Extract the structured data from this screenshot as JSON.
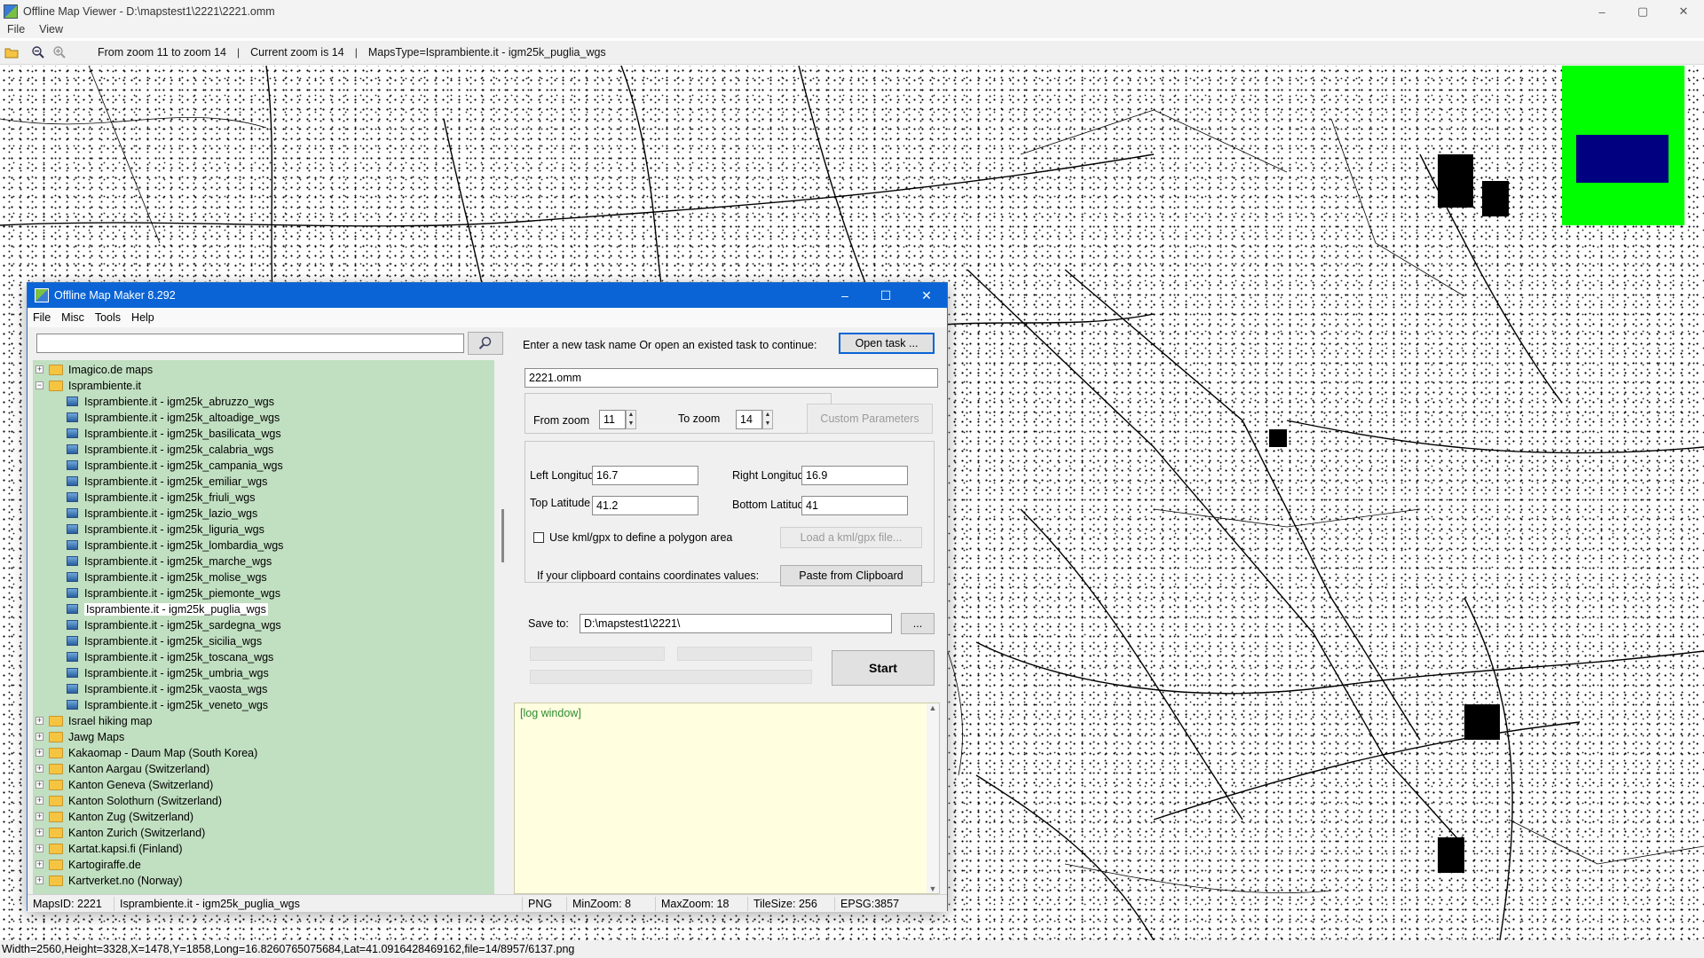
{
  "window": {
    "title": "Offline Map Viewer - D:\\mapstest1\\2221\\2221.omm",
    "minimize": "–",
    "maximize": "▢",
    "close": "✕"
  },
  "menu": {
    "file": "File",
    "view": "View"
  },
  "toolbar": {
    "zoom_range": "From zoom 11 to zoom 14",
    "separator": "|",
    "current_zoom": "Current zoom is 14",
    "maps_type": "MapsType=Isprambiente.it - igm25k_puglia_wgs"
  },
  "minimap": {
    "background_color": "#00ff00",
    "view_color": "#000080"
  },
  "dialog": {
    "title": "Offline Map Maker 8.292",
    "minimize": "–",
    "maximize": "☐",
    "close": "✕",
    "menu": {
      "file": "File",
      "misc": "Misc",
      "tools": "Tools",
      "help": "Help"
    },
    "search": {
      "value": "",
      "placeholder": ""
    },
    "tree": [
      {
        "label": "Imagico.de maps",
        "level": 0,
        "type": "folder",
        "expanded": false
      },
      {
        "label": "Isprambiente.it",
        "level": 0,
        "type": "folder",
        "expanded": true
      },
      {
        "label": "Isprambiente.it - igm25k_abruzzo_wgs",
        "level": 1,
        "type": "map"
      },
      {
        "label": "Isprambiente.it - igm25k_altoadige_wgs",
        "level": 1,
        "type": "map"
      },
      {
        "label": "Isprambiente.it - igm25k_basilicata_wgs",
        "level": 1,
        "type": "map"
      },
      {
        "label": "Isprambiente.it - igm25k_calabria_wgs",
        "level": 1,
        "type": "map"
      },
      {
        "label": "Isprambiente.it - igm25k_campania_wgs",
        "level": 1,
        "type": "map"
      },
      {
        "label": "Isprambiente.it - igm25k_emiliar_wgs",
        "level": 1,
        "type": "map"
      },
      {
        "label": "Isprambiente.it - igm25k_friuli_wgs",
        "level": 1,
        "type": "map"
      },
      {
        "label": "Isprambiente.it - igm25k_lazio_wgs",
        "level": 1,
        "type": "map"
      },
      {
        "label": "Isprambiente.it - igm25k_liguria_wgs",
        "level": 1,
        "type": "map"
      },
      {
        "label": "Isprambiente.it - igm25k_lombardia_wgs",
        "level": 1,
        "type": "map"
      },
      {
        "label": "Isprambiente.it - igm25k_marche_wgs",
        "level": 1,
        "type": "map"
      },
      {
        "label": "Isprambiente.it - igm25k_molise_wgs",
        "level": 1,
        "type": "map"
      },
      {
        "label": "Isprambiente.it - igm25k_piemonte_wgs",
        "level": 1,
        "type": "map"
      },
      {
        "label": "Isprambiente.it - igm25k_puglia_wgs",
        "level": 1,
        "type": "map",
        "selected": true
      },
      {
        "label": "Isprambiente.it - igm25k_sardegna_wgs",
        "level": 1,
        "type": "map"
      },
      {
        "label": "Isprambiente.it - igm25k_sicilia_wgs",
        "level": 1,
        "type": "map"
      },
      {
        "label": "Isprambiente.it - igm25k_toscana_wgs",
        "level": 1,
        "type": "map"
      },
      {
        "label": "Isprambiente.it - igm25k_umbria_wgs",
        "level": 1,
        "type": "map"
      },
      {
        "label": "Isprambiente.it - igm25k_vaosta_wgs",
        "level": 1,
        "type": "map"
      },
      {
        "label": "Isprambiente.it - igm25k_veneto_wgs",
        "level": 1,
        "type": "map"
      },
      {
        "label": "Israel hiking map",
        "level": 0,
        "type": "folder",
        "expanded": false
      },
      {
        "label": "Jawg Maps",
        "level": 0,
        "type": "folder",
        "expanded": false
      },
      {
        "label": "Kakaomap - Daum Map (South Korea)",
        "level": 0,
        "type": "folder",
        "expanded": false
      },
      {
        "label": "Kanton Aargau (Switzerland)",
        "level": 0,
        "type": "folder",
        "expanded": false
      },
      {
        "label": "Kanton Geneva (Switzerland)",
        "level": 0,
        "type": "folder",
        "expanded": false
      },
      {
        "label": "Kanton Solothurn (Switzerland)",
        "level": 0,
        "type": "folder",
        "expanded": false
      },
      {
        "label": "Kanton Zug (Switzerland)",
        "level": 0,
        "type": "folder",
        "expanded": false
      },
      {
        "label": "Kanton Zurich (Switzerland)",
        "level": 0,
        "type": "folder",
        "expanded": false
      },
      {
        "label": "Kartat.kapsi.fi (Finland)",
        "level": 0,
        "type": "folder",
        "expanded": false
      },
      {
        "label": "Kartogiraffe.de",
        "level": 0,
        "type": "folder",
        "expanded": false
      },
      {
        "label": "Kartverket.no (Norway)",
        "level": 0,
        "type": "folder",
        "expanded": false
      }
    ],
    "task": {
      "prompt": "Enter a new task name Or open an existed task to continue:",
      "open_button": "Open task ...",
      "name_value": "2221.omm"
    },
    "zoom": {
      "from_label": "From zoom",
      "from_value": "11",
      "to_label": "To zoom",
      "to_value": "14",
      "custom_button": "Custom Parameters"
    },
    "coords": {
      "left_lon_label": "Left Longitude",
      "left_lon_value": "16.7",
      "right_lon_label": "Right Longitude",
      "right_lon_value": "16.9",
      "top_lat_label": "Top Latitude",
      "top_lat_value": "41.2",
      "bottom_lat_label": "Bottom Latitude",
      "bottom_lat_value": "41",
      "kml_checkbox_label": "Use kml/gpx to define a polygon area",
      "kml_checked": false,
      "load_kml_button": "Load a kml/gpx file...",
      "clipboard_label": "If your clipboard contains coordinates values:",
      "paste_button": "Paste from Clipboard"
    },
    "save": {
      "label": "Save to:",
      "value": "D:\\mapstest1\\2221\\",
      "browse_button": "...",
      "start_button": "Start"
    },
    "log": {
      "text": "[log window]"
    },
    "status": {
      "maps_id": "MapsID: 2221",
      "maps_name": "Isprambiente.it - igm25k_puglia_wgs",
      "format": "PNG",
      "min_zoom": "MinZoom: 8",
      "max_zoom": "MaxZoom: 18",
      "tile_size": "TileSize: 256",
      "epsg": "EPSG:3857"
    }
  },
  "statusbar": {
    "text": "Width=2560,Height=3328,X=1478,Y=1858,Long=16.8260765075684,Lat=41.0916428469162,file=14/8957/6137.png"
  }
}
